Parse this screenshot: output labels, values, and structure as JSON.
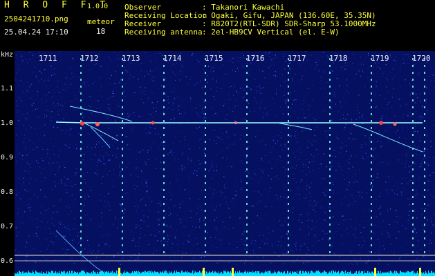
{
  "app": {
    "brand": "H R O F F T",
    "version": "1.0.0",
    "filename": "2504241710.png",
    "datetime": "25.04.24 17:10",
    "meteor_label": "meteor",
    "meteor_count": "18"
  },
  "station": {
    "observer_label": "Observer",
    "observer_value": ": Takanori Kawachi",
    "location_label": "Receiving Location",
    "location_value": ": Ogaki, Gifu, JAPAN (136.60E, 35.35N)",
    "receiver_label": "Receiver",
    "receiver_value": ": R820T2(RTL-SDR) SDR-Sharp 53.1000MHz",
    "antenna_label": "Receiving antenna",
    "antenna_value": ": 2el-HB9CV Vertical (el. E-W)"
  },
  "axis": {
    "y_unit": "kHz",
    "y_ticks": [
      "1.1",
      "1.0",
      "0.9",
      "0.8",
      "0.7",
      "0.6"
    ],
    "x_ticks": [
      "1711",
      "1712",
      "1713",
      "1714",
      "1715",
      "1716",
      "1717",
      "1718",
      "1719",
      "1720"
    ]
  },
  "colors": {
    "background": "#000000",
    "noise_bg": "#061060",
    "carrier": "#9fffff",
    "label_yellow": "#ffff3c",
    "label_white": "#f4f4f4",
    "meter": "#00e0ff"
  }
}
